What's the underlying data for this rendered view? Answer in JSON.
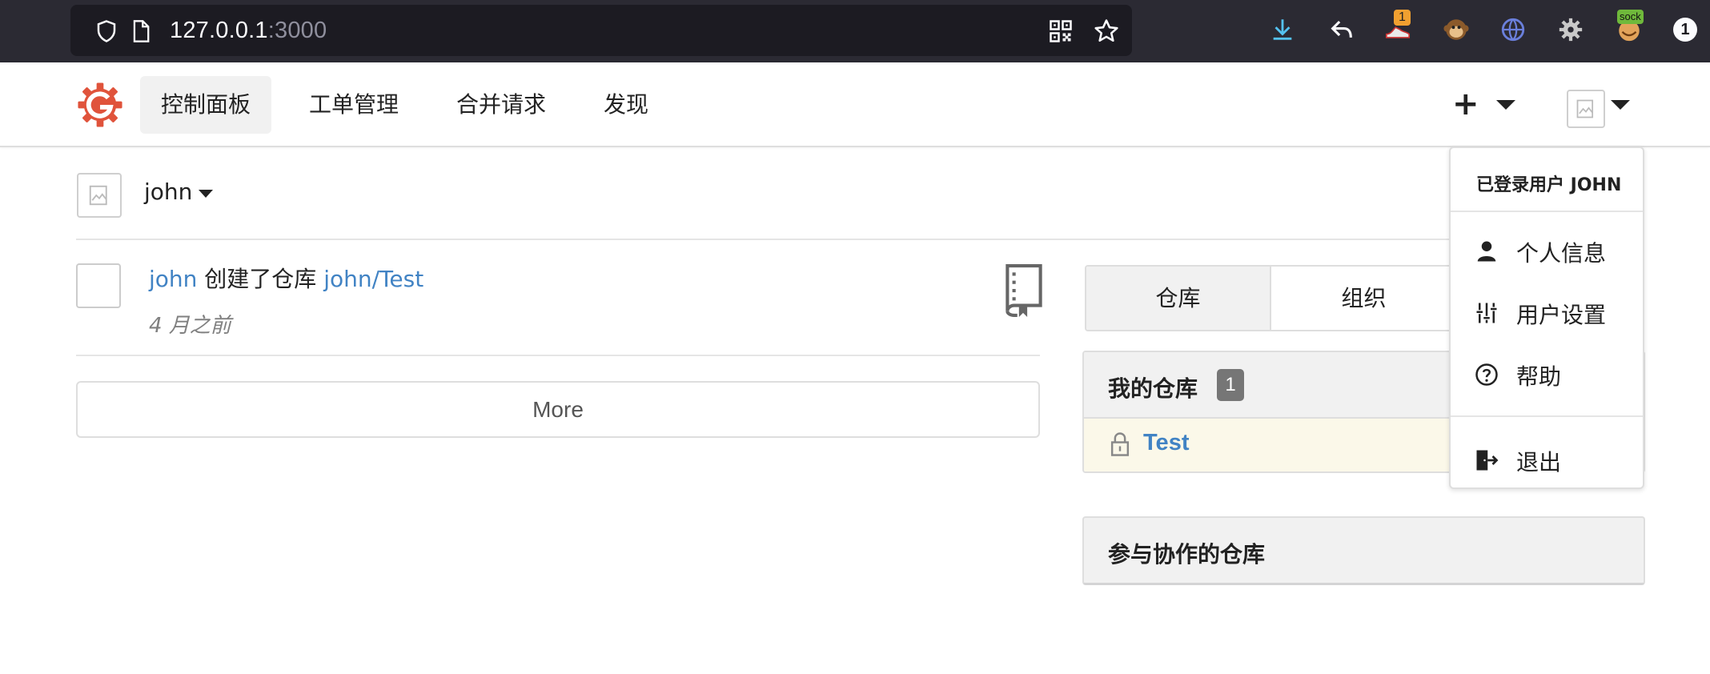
{
  "browser": {
    "url_host": "127.0.0.1",
    "url_port": ":3000",
    "extension_badge": "1",
    "sock_badge": "sock",
    "account_badge": "1"
  },
  "nav": {
    "items": [
      "控制面板",
      "工单管理",
      "合并请求",
      "发现"
    ]
  },
  "context": {
    "user": "john"
  },
  "feed": {
    "actor": "john",
    "action": " 创建了仓库 ",
    "repo": "john/Test",
    "time": "4 月之前",
    "more_label": "More"
  },
  "dashboard": {
    "tabs": [
      "仓库",
      "组织"
    ],
    "my_repos_title": "我的仓库",
    "my_repos_count": "1",
    "repo_name": "Test",
    "collab_title": "参与协作的仓库"
  },
  "user_menu": {
    "header": "已登录用户 JOHN",
    "profile": "个人信息",
    "settings": "用户设置",
    "help": "帮助",
    "signout": "退出"
  },
  "colors": {
    "link": "#4183c4",
    "brand": "#e0533b",
    "chrome": "#2b2a33"
  }
}
